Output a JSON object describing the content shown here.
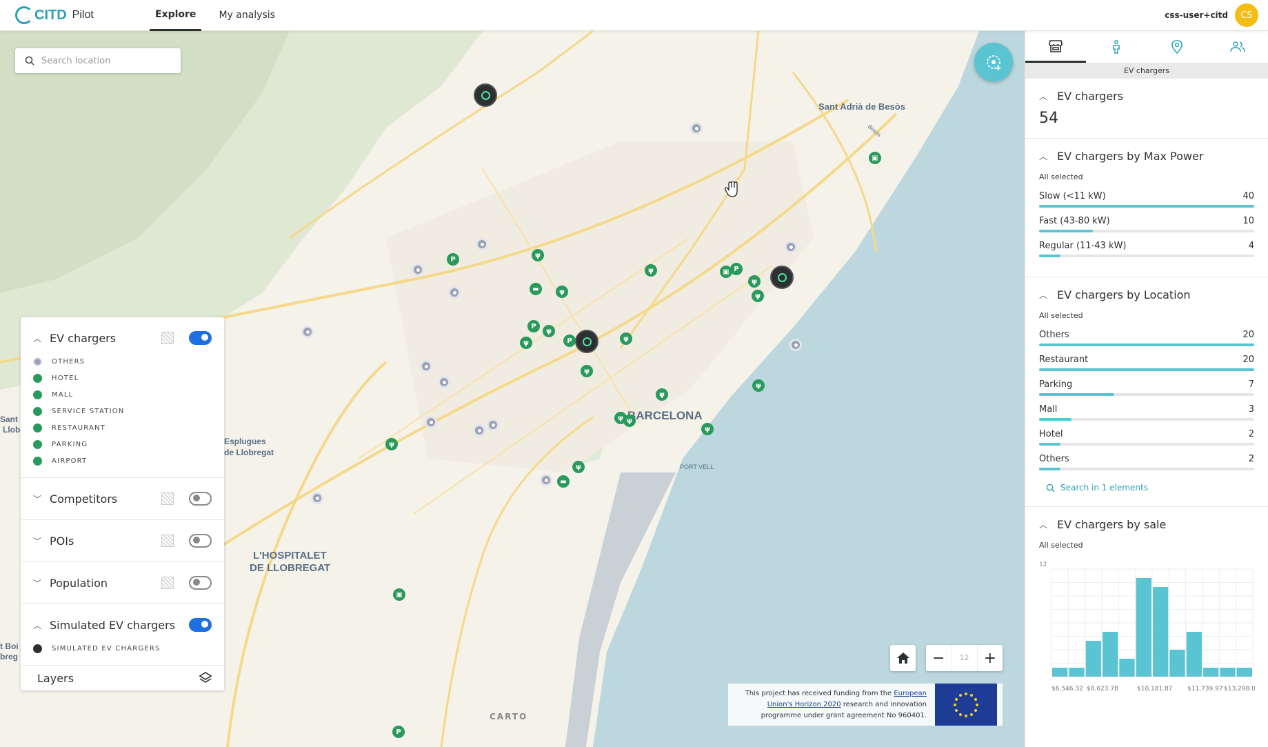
{
  "header": {
    "logo_mark": "CITD",
    "logo_name": "CITD",
    "logo_pilot": "Pilot",
    "tabs": [
      {
        "label": "Explore",
        "active": true
      },
      {
        "label": "My analysis",
        "active": false
      }
    ],
    "user_name": "css-user+citd",
    "avatar_initials": "CS",
    "avatar_color": "#f4bd14"
  },
  "map": {
    "search_placeholder": "Search location",
    "zoom_level": "12",
    "labels": {
      "barcelona": "BARCELONA",
      "sant_adria": "Sant Adrià de Besòs",
      "esplugues_1": "Esplugues",
      "esplugues_2": "de Llobregat",
      "hospitalet_1": "L'HOSPITALET",
      "hospitalet_2": "DE LLOBREGAT",
      "port_vell": "PORT VELL",
      "sant_left_1": "Sant I",
      "sant_left_2": "Llob",
      "boi_left_1": "t Boi",
      "boi_left_2": "breg",
      "besos": "Besòs"
    },
    "attribution": "CARTO",
    "funding": {
      "prefix": "This project has received funding from the ",
      "link": "European Union's Horizon 2020",
      "suffix": " research and innovation programme under grant agreement No 960401."
    }
  },
  "legend": {
    "ev": {
      "title": "EV chargers",
      "enabled": true,
      "items": [
        {
          "label": "OTHERS",
          "color": "#9aa0b5"
        },
        {
          "label": "HOTEL",
          "color": "#2a9a5c"
        },
        {
          "label": "MALL",
          "color": "#2a9a5c"
        },
        {
          "label": "SERVICE STATION",
          "color": "#2a9a5c"
        },
        {
          "label": "RESTAURANT",
          "color": "#2a9a5c"
        },
        {
          "label": "PARKING",
          "color": "#2a9a5c"
        },
        {
          "label": "AIRPORT",
          "color": "#2a9a5c"
        }
      ]
    },
    "competitors": {
      "title": "Competitors",
      "enabled": false
    },
    "pois": {
      "title": "POIs",
      "enabled": false
    },
    "population": {
      "title": "Population",
      "enabled": false
    },
    "simulated": {
      "title": "Simulated EV chargers",
      "enabled": true,
      "item": "SIMULATED EV CHARGERS"
    },
    "layers_label": "Layers"
  },
  "panel": {
    "tab_caption": "EV chargers",
    "tab_icons": [
      "store-icon",
      "person-icon",
      "pin-icon",
      "people-icon"
    ],
    "count_widget": {
      "title": "EV chargers",
      "value": "54"
    },
    "power_widget": {
      "title": "EV chargers by Max Power",
      "subtitle": "All selected",
      "rows": [
        {
          "label": "Slow (<11 kW)",
          "value": "40",
          "fraction": 1.0
        },
        {
          "label": "Fast (43-80 kW)",
          "value": "10",
          "fraction": 0.25
        },
        {
          "label": "Regular (11-43 kW)",
          "value": "4",
          "fraction": 0.1
        }
      ]
    },
    "location_widget": {
      "title": "EV chargers by Location",
      "subtitle": "All selected",
      "rows": [
        {
          "label": "Others",
          "value": "20",
          "fraction": 1.0
        },
        {
          "label": "Restaurant",
          "value": "20",
          "fraction": 1.0
        },
        {
          "label": "Parking",
          "value": "7",
          "fraction": 0.35
        },
        {
          "label": "Mall",
          "value": "3",
          "fraction": 0.15
        },
        {
          "label": "Hotel",
          "value": "2",
          "fraction": 0.1
        },
        {
          "label": "Others",
          "value": "2",
          "fraction": 0.1
        }
      ],
      "search_link": "Search in 1 elements"
    },
    "sale_widget": {
      "title": "EV chargers by sale",
      "subtitle": "All selected"
    }
  },
  "chart_data": {
    "type": "bar",
    "title": "EV chargers by sale",
    "ylim": [
      0,
      12
    ],
    "y_tick_label": "12",
    "x_tick_labels": [
      "$6,546.32",
      "$8,623.78",
      "$10,181.87",
      "$11,739.97",
      "$13,298.06"
    ],
    "values": [
      1,
      1,
      4,
      5,
      2,
      11,
      10,
      3,
      5,
      1,
      1,
      1
    ],
    "color": "#5bc4d2"
  }
}
